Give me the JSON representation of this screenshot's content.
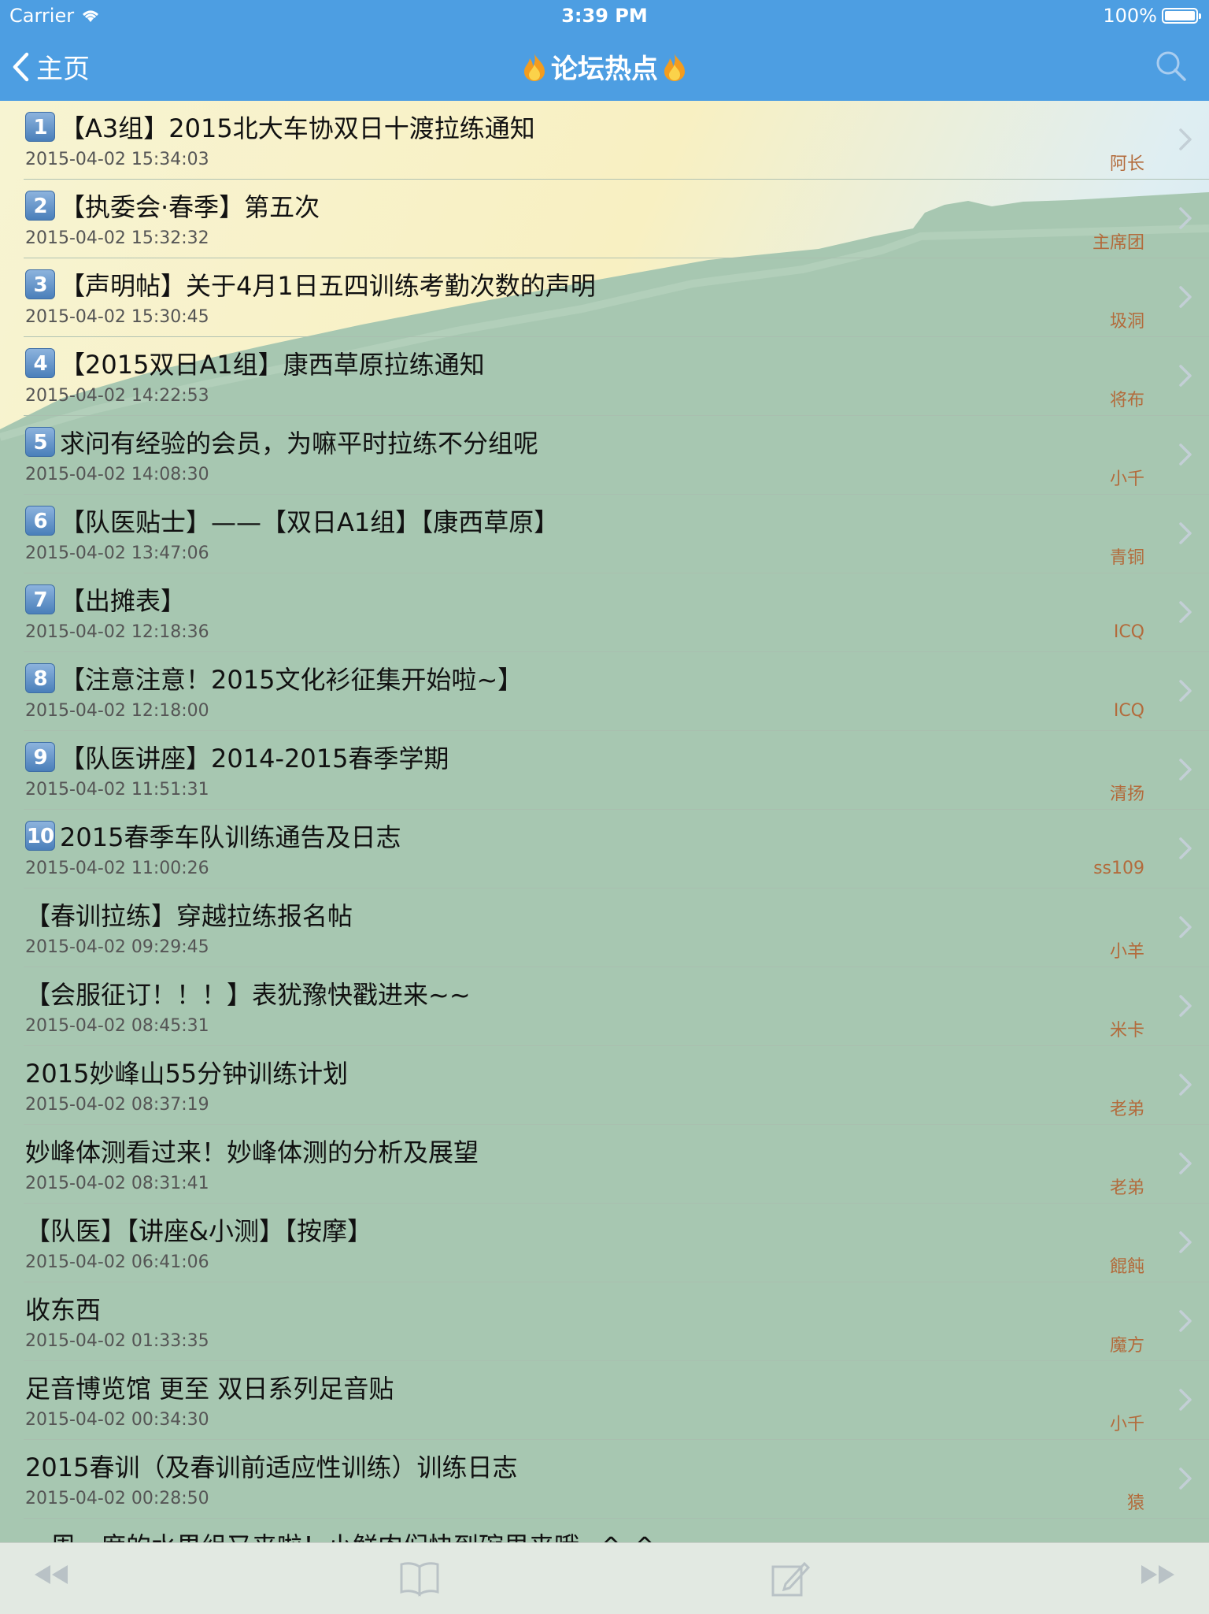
{
  "status_bar": {
    "carrier": "Carrier",
    "time": "3:39 PM",
    "battery": "100%"
  },
  "nav": {
    "back_label": "主页",
    "title": "论坛热点",
    "title_icon": "fire-icon",
    "search_icon": "search-icon"
  },
  "threads": [
    {
      "rank": "1",
      "title": "【A3组】2015北大车协双日十渡拉练通知",
      "date": "2015-04-02 15:34:03",
      "author": "阿长"
    },
    {
      "rank": "2",
      "title": "【执委会·春季】第五次",
      "date": "2015-04-02 15:32:32",
      "author": "主席团"
    },
    {
      "rank": "3",
      "title": "【声明帖】关于4月1日五四训练考勤次数的声明",
      "date": "2015-04-02 15:30:45",
      "author": "圾洞"
    },
    {
      "rank": "4",
      "title": "【2015双日A1组】康西草原拉练通知",
      "date": "2015-04-02 14:22:53",
      "author": "将布"
    },
    {
      "rank": "5",
      "title": "求问有经验的会员，为嘛平时拉练不分组呢",
      "date": "2015-04-02 14:08:30",
      "author": "小千"
    },
    {
      "rank": "6",
      "title": "【队医贴士】——【双日A1组】【康西草原】",
      "date": "2015-04-02 13:47:06",
      "author": "青铜"
    },
    {
      "rank": "7",
      "title": "【出摊表】",
      "date": "2015-04-02 12:18:36",
      "author": "ICQ"
    },
    {
      "rank": "8",
      "title": "【注意注意！2015文化衫征集开始啦~】",
      "date": "2015-04-02 12:18:00",
      "author": "ICQ"
    },
    {
      "rank": "9",
      "title": "【队医讲座】2014-2015春季学期",
      "date": "2015-04-02 11:51:31",
      "author": "清扬"
    },
    {
      "rank": "10",
      "title": "2015春季车队训练通告及日志",
      "date": "2015-04-02 11:00:26",
      "author": "ss109"
    },
    {
      "rank": "",
      "title": "【春训拉练】穿越拉练报名帖",
      "date": "2015-04-02 09:29:45",
      "author": "小羊"
    },
    {
      "rank": "",
      "title": "【会服征订！！！】表犹豫快戳进来~~",
      "date": "2015-04-02 08:45:31",
      "author": "米卡"
    },
    {
      "rank": "",
      "title": "2015妙峰山55分钟训练计划",
      "date": "2015-04-02 08:37:19",
      "author": "老弟"
    },
    {
      "rank": "",
      "title": "妙峰体测看过来！妙峰体测的分析及展望",
      "date": "2015-04-02 08:31:41",
      "author": "老弟"
    },
    {
      "rank": "",
      "title": "【队医】【讲座&小测】【按摩】",
      "date": "2015-04-02 06:41:06",
      "author": "餛飩"
    },
    {
      "rank": "",
      "title": "收东西",
      "date": "2015-04-02 01:33:35",
      "author": "魔方"
    },
    {
      "rank": "",
      "title": "足音博览馆 更至 双日系列足音贴",
      "date": "2015-04-02 00:34:30",
      "author": "小千"
    },
    {
      "rank": "",
      "title": "2015春训（及春训前适应性训练）训练日志",
      "date": "2015-04-02 00:28:50",
      "author": "猿"
    },
    {
      "rank": "",
      "title": "一周一度的水果组又来啦！小鲜肉们快到碗里来哦~^_^",
      "date": "",
      "author": ""
    }
  ],
  "toolbar": {
    "icons": [
      "rewind-icon",
      "book-icon",
      "compose-icon",
      "fast-forward-icon"
    ]
  },
  "colors": {
    "nav_bg": "#4d9ee2",
    "author": "#b36b3c",
    "badge": "#4a7fba",
    "background_green": "#a7c7b1",
    "background_sky": "#f7f1c8"
  }
}
